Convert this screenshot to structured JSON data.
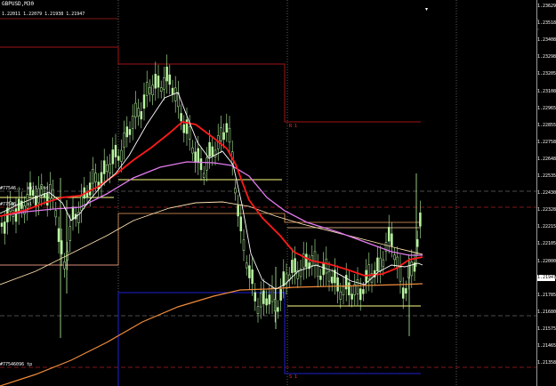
{
  "window": {
    "symbol": "GBPUSD,M30",
    "ohlc": "1.22011 1.22079 1.21938 1.21947"
  },
  "price_axis": {
    "ticks": [
      "1.23629",
      "1.23518",
      "1.23408",
      "1.23298",
      "1.23205",
      "1.23108",
      "1.22965",
      "1.22855",
      "1.22758",
      "1.22648",
      "1.22535",
      "1.22430",
      "1.22328",
      "1.22215",
      "1.22105",
      "1.22000",
      "1.21890",
      "1.21785",
      "1.21680",
      "1.21575",
      "1.21465",
      "1.21358"
    ],
    "current_price": "1.21947"
  },
  "labels": {
    "line1": "#77546... sell ltd",
    "line2": "#77546... sl",
    "line3": "#77546... tp",
    "line4": "#77546... sell",
    "line5": "#77546096 tp",
    "marker_top": "R 1",
    "marker_bottom": "S 1"
  },
  "colors": {
    "background": "#000000",
    "bull_candle": "#b8f5a0",
    "bear_candle": "#d9ffc9",
    "ema_red": "#ff1a1a",
    "ema_violet": "#e37cf0",
    "ema_white": "#ffffff",
    "ema_cream": "#ffe0b0",
    "ema_orange": "#f08c3c",
    "level_yellow": "#ffff80",
    "pivot_dark_red": "#a01414",
    "pivot_blue": "#2020d0"
  }
}
